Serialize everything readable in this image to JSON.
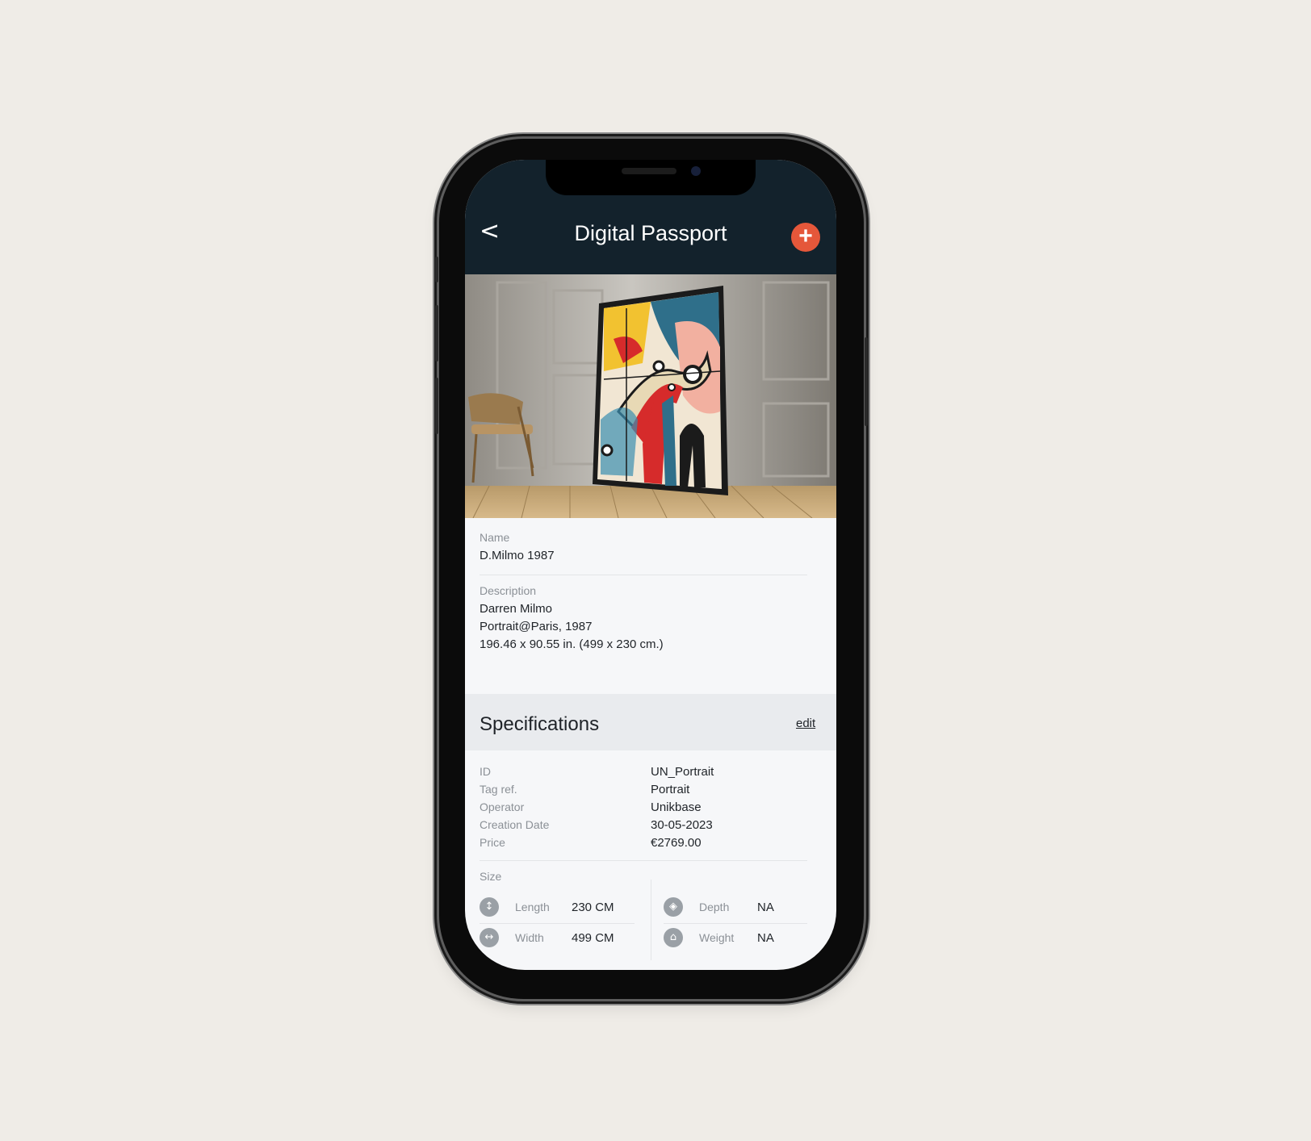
{
  "header": {
    "back_icon": "chevron-left-icon",
    "back_glyph": "<",
    "title": "Digital Passport",
    "add_icon": "plus-icon",
    "add_glyph": "+"
  },
  "artwork": {
    "image_kind": "photo-painting-in-room"
  },
  "details": {
    "name_label": "Name",
    "name_value": "D.Milmo 1987",
    "description_label": "Description",
    "description_lines": [
      "Darren Milmo",
      "Portrait@Paris, 1987",
      "196.46 x 90.55 in. (499 x 230 cm.)"
    ]
  },
  "specifications": {
    "title": "Specifications",
    "edit_label": "edit",
    "rows": [
      {
        "label": "ID",
        "value": "UN_Portrait"
      },
      {
        "label": "Tag ref.",
        "value": "Portrait"
      },
      {
        "label": "Operator",
        "value": "Unikbase"
      },
      {
        "label": "Creation Date",
        "value": "30-05-2023"
      },
      {
        "label": "Price",
        "value": "€2769.00"
      }
    ],
    "size_label": "Size",
    "size": {
      "length": {
        "label": "Length",
        "value": "230 CM",
        "icon": "length-icon"
      },
      "width": {
        "label": "Width",
        "value": "499 CM",
        "icon": "width-icon"
      },
      "depth": {
        "label": "Depth",
        "value": "NA",
        "icon": "depth-icon"
      },
      "weight": {
        "label": "Weight",
        "value": "NA",
        "icon": "weight-icon"
      }
    }
  },
  "colors": {
    "background": "#efece7",
    "header": "#13222c",
    "accent": "#e5573a"
  }
}
